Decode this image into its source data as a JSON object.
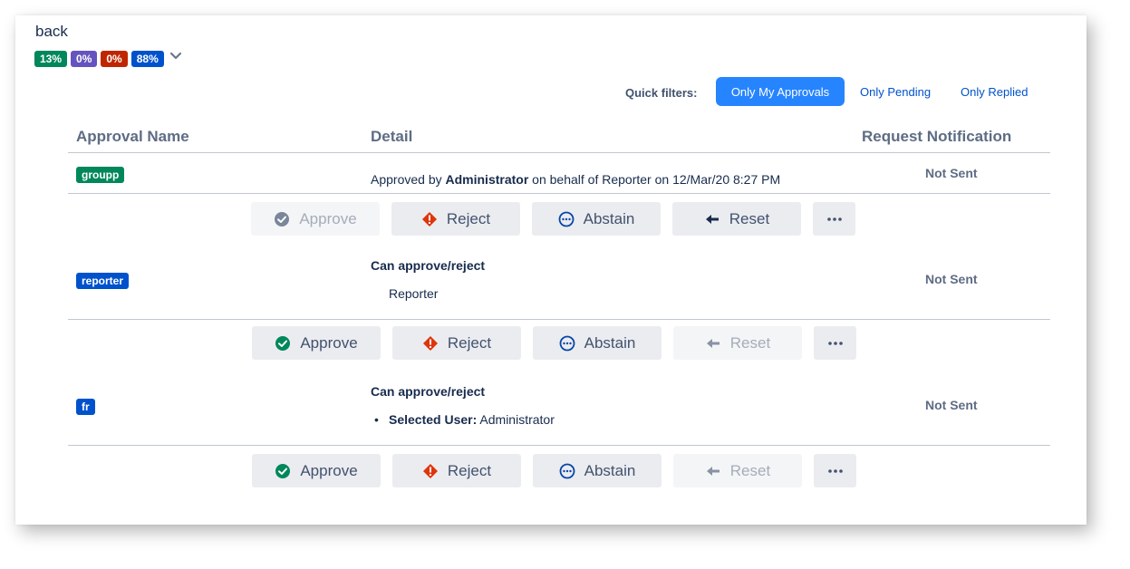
{
  "back_label": "back",
  "progress_badges": [
    {
      "label": "13%",
      "color": "#00875a"
    },
    {
      "label": "0%",
      "color": "#6554c0"
    },
    {
      "label": "0%",
      "color": "#bf2600"
    },
    {
      "label": "88%",
      "color": "#0052cc"
    }
  ],
  "quick_filters": {
    "label": "Quick filters:",
    "active": "Only My Approvals",
    "options": [
      "Only Pending",
      "Only Replied"
    ]
  },
  "columns": [
    "Approval Name",
    "Detail",
    "Request Notification"
  ],
  "rows": [
    {
      "name": "groupp",
      "name_color": "#00875a",
      "detail_prefix": "Approved by ",
      "detail_bold": "Administrator",
      "detail_suffix": " on behalf of Reporter on 12/Mar/20 8:27 PM",
      "notification": "Not Sent"
    },
    {
      "name": "reporter",
      "name_color": "#0052cc",
      "detail_heading": "Can approve/reject",
      "detail_line": "Reporter",
      "notification": "Not Sent"
    },
    {
      "name": "fr",
      "name_color": "#0052cc",
      "detail_heading": "Can approve/reject",
      "detail_bullet_label": "Selected User:",
      "detail_bullet_value": "Administrator",
      "notification": "Not Sent"
    }
  ],
  "buttons": {
    "approve": "Approve",
    "reject": "Reject",
    "abstain": "Abstain",
    "reset": "Reset",
    "more": "more-actions"
  },
  "colors": {
    "approve_icon": "#00875a",
    "reject_icon": "#de350b",
    "abstain_icon": "#0747a6",
    "primary": "#2684ff"
  }
}
